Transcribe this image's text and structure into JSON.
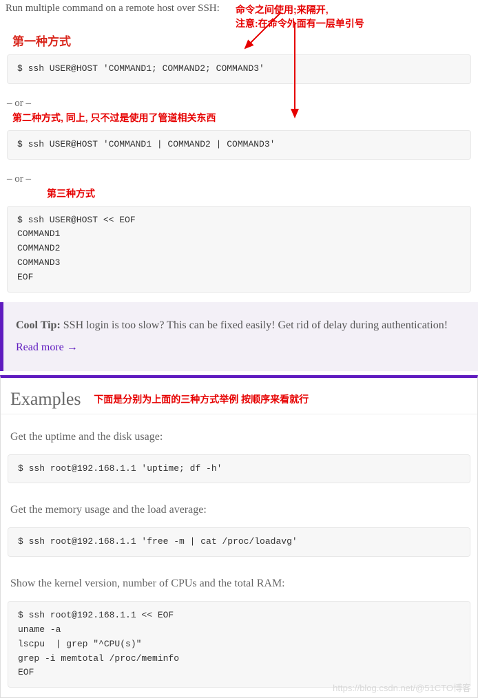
{
  "intro": "Run multiple command on a remote host over SSH:",
  "anno": {
    "method1": "第一种方式",
    "note1a": "命令之间使用;来隔开,",
    "note1b": "注意:在命令外面有一层单引号",
    "method2": "第二种方式, 同上, 只不过是使用了管道相关东西",
    "method3": "第三种方式",
    "examples_note": "下面是分别为上面的三种方式举例 按顺序来看就行"
  },
  "code1": "$ ssh USER@HOST 'COMMAND1; COMMAND2; COMMAND3'",
  "or": "– or –",
  "code2": "$ ssh USER@HOST 'COMMAND1 | COMMAND2 | COMMAND3'",
  "code3": "$ ssh USER@HOST << EOF\nCOMMAND1\nCOMMAND2\nCOMMAND3\nEOF",
  "tip": {
    "bold": "Cool Tip:",
    "text": " SSH login is too slow? This can be fixed easily! Get rid of delay during authentication! ",
    "link": "Read more →"
  },
  "examples": {
    "title": "Examples",
    "p1": "Get the uptime and the disk usage:",
    "c1": "$ ssh root@192.168.1.1 'uptime; df -h'",
    "p2": "Get the memory usage and the load average:",
    "c2": "$ ssh root@192.168.1.1 'free -m | cat /proc/loadavg'",
    "p3": "Show the kernel version, number of CPUs and the total RAM:",
    "c3": "$ ssh root@192.168.1.1 << EOF\nuname -a\nlscpu  | grep \"^CPU(s)\"\ngrep -i memtotal /proc/meminfo\nEOF"
  },
  "watermark": "https://blog.csdn.net/@51CTO博客"
}
